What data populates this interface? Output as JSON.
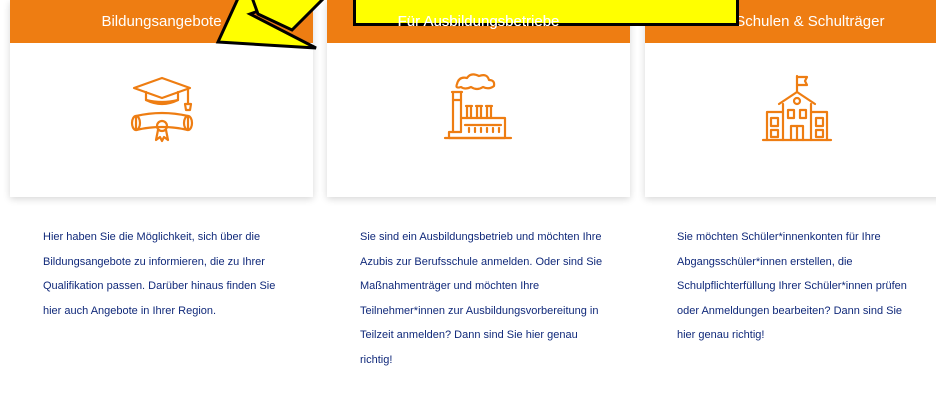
{
  "cards": [
    {
      "title": "Bildungsangebote",
      "icon": "graduation-cap-diploma-icon",
      "description": "Hier haben Sie die Möglichkeit, sich über die Bildungsangebote zu informieren, die zu Ihrer Qualifikation passen. Darüber hinaus finden Sie hier auch Angebote in Ihrer Region."
    },
    {
      "title": "Für Ausbildungsbetriebe",
      "icon": "factory-icon",
      "description": "Sie sind ein Ausbildungsbetrieb und möchten Ihre Azubis zur Berufsschule anmelden. Oder sind Sie Maßnahmenträger und möchten Ihre Teilnehmer*innen zur Ausbildungsvorbereitung in Teilzeit anmelden? Dann sind Sie hier genau richtig!"
    },
    {
      "title": "Für Schulen & Schulträger",
      "icon": "school-building-icon",
      "description": "Sie möchten Schüler*innenkonten für Ihre Abgangsschüler*innen erstellen, die Schulpflichterfüllung Ihrer Schüler*innen prüfen oder Anmeldungen bearbeiten? Dann sind Sie hier genau richtig!"
    }
  ],
  "colors": {
    "accent": "#ee7d12",
    "text": "#10297a",
    "highlight": "#ffff00"
  }
}
